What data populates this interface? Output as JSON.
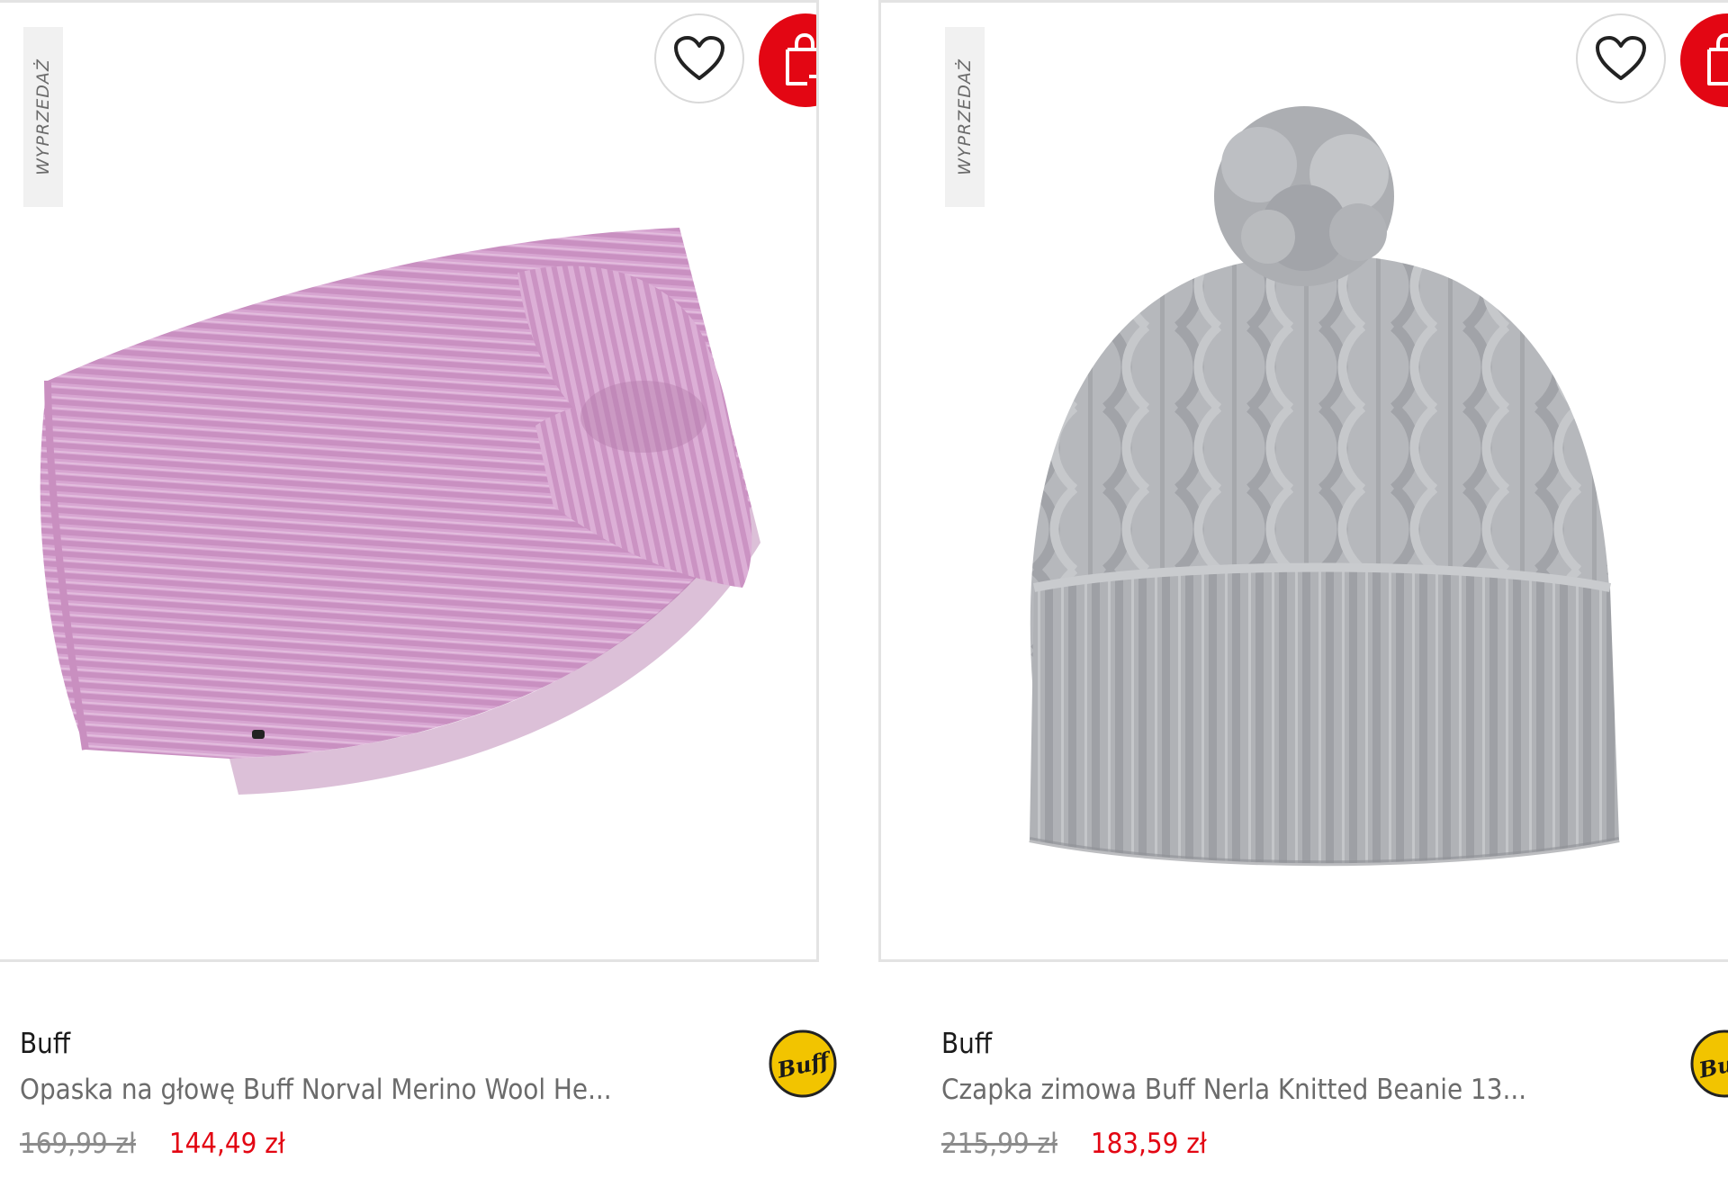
{
  "products": [
    {
      "badge": "WYPRZEDAŻ",
      "brand": "Buff",
      "name": "Opaska na głowę Buff Norval Merino Wool He...",
      "old_price": "169,99 zł",
      "price": "144,49 zł",
      "logo_text": "Buff",
      "image": "pink-knitted-headband"
    },
    {
      "badge": "WYPRZEDAŻ",
      "brand": "Buff",
      "name": "Czapka zimowa Buff Nerla Knitted Beanie 13...",
      "old_price": "215,99 zł",
      "price": "183,59 zł",
      "logo_text": "Buff",
      "image": "grey-knitted-beanie-with-pompom"
    }
  ],
  "icons": {
    "favorite": "heart-icon",
    "cart": "add-to-cart-icon"
  },
  "colors": {
    "accent": "#e30613",
    "badge_bg": "#f1f1f1",
    "logo_yellow": "#f2c400"
  }
}
